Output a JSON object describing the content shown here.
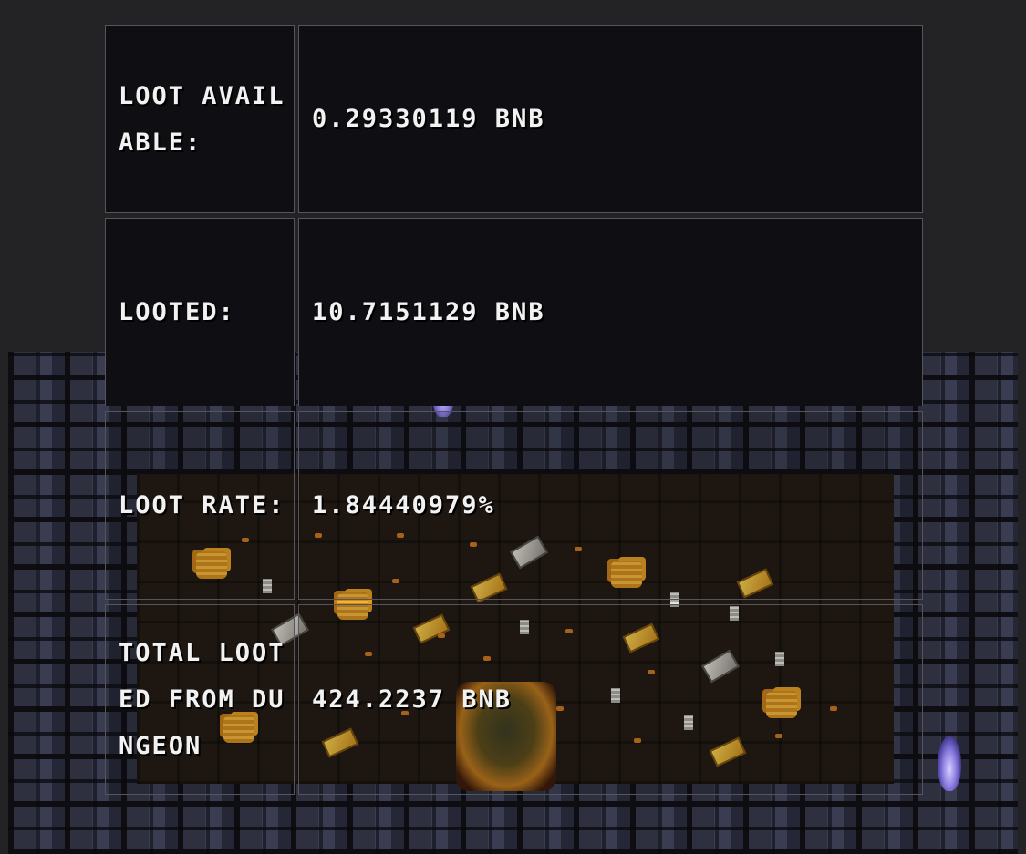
{
  "loot_table": {
    "rows": [
      {
        "label": "LOOT AVAILABLE:",
        "value": "0.29330119 BNB"
      },
      {
        "label": "LOOTED:",
        "value": "10.7151129 BNB"
      },
      {
        "label": "LOOT RATE:",
        "value": "1.84440979%"
      },
      {
        "label": "TOTAL LOOTED FROM DUNGEON",
        "value": "424.2237 BNB"
      }
    ]
  },
  "colors": {
    "page_background": "#232326",
    "cell_background": "#0f0e12",
    "cell_border": "#55555d",
    "text": "#f2f2f2",
    "gold": "#f0b33a",
    "torch_flame": "#8a7de0"
  },
  "icons": [
    "torch-icon",
    "coin-pile-icon",
    "gold-bar-icon",
    "silver-bar-icon",
    "hero-sprite"
  ]
}
